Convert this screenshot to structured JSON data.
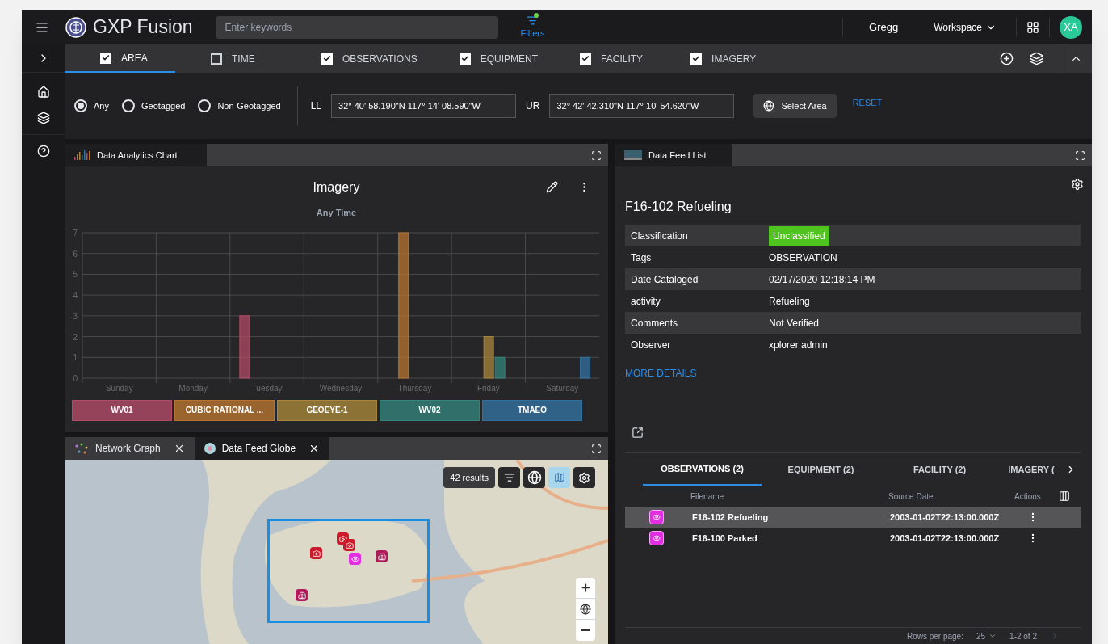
{
  "app": {
    "name": "GXP Fusion"
  },
  "search": {
    "placeholder": "Enter keywords"
  },
  "filters_button": {
    "label": "Filters"
  },
  "user": {
    "name": "Gregg",
    "workspace": "Workspace",
    "initials": "XA"
  },
  "filter_tabs": [
    {
      "label": "AREA",
      "checked": true,
      "selected": true
    },
    {
      "label": "TIME",
      "checked": false,
      "selected": false
    },
    {
      "label": "OBSERVATIONS",
      "checked": true,
      "selected": false
    },
    {
      "label": "EQUIPMENT",
      "checked": true,
      "selected": false
    },
    {
      "label": "FACILITY",
      "checked": true,
      "selected": false
    },
    {
      "label": "IMAGERY",
      "checked": true,
      "selected": false
    }
  ],
  "geo_options": [
    {
      "label": "Any",
      "selected": true
    },
    {
      "label": "Geotagged",
      "selected": false
    },
    {
      "label": "Non-Geotagged",
      "selected": false
    }
  ],
  "coordinates": [
    {
      "label": "LL",
      "value": "32° 40' 58.190\"N 117° 14' 08.590\"W"
    },
    {
      "label": "UR",
      "value": "32° 42' 42.310\"N 117° 10' 54.620\"W"
    }
  ],
  "select_area": "Select Area",
  "reset": "RESET",
  "chart_panel": {
    "tab": "Data Analytics Chart",
    "subtitle": "Any Time",
    "chart_data": {
      "type": "bar",
      "title": "Imagery",
      "grid": true,
      "categories": [
        "Sunday",
        "Monday",
        "Tuesday",
        "Wednesday",
        "Thursday",
        "Friday",
        "Saturday"
      ],
      "ylim": [
        0,
        7
      ],
      "yticks": [
        0,
        1,
        2,
        3,
        4,
        5,
        6,
        7
      ],
      "series": [
        {
          "name": "WV01",
          "color": "#b14b66",
          "values": [
            null,
            null,
            3,
            null,
            null,
            null,
            null
          ]
        },
        {
          "name": "CUBIC RATIONAL ...",
          "color": "#b8742f",
          "values": [
            null,
            null,
            null,
            null,
            7,
            null,
            null
          ]
        },
        {
          "name": "GEOEYE-1",
          "color": "#a8863a",
          "values": [
            null,
            null,
            null,
            null,
            null,
            2,
            null
          ]
        },
        {
          "name": "WV02",
          "color": "#35837a",
          "values": [
            null,
            null,
            null,
            null,
            null,
            1,
            null
          ]
        },
        {
          "name": "TMAEO",
          "color": "#33709f",
          "values": [
            null,
            null,
            null,
            null,
            null,
            null,
            1
          ]
        }
      ]
    }
  },
  "map_panel": {
    "tabs": [
      {
        "label": "Network Graph",
        "selected": false
      },
      {
        "label": "Data Feed Globe",
        "selected": true
      }
    ],
    "results": "42 results"
  },
  "feed_panel": {
    "tab": "Data Feed List",
    "title": "F16-102 Refueling",
    "details": [
      {
        "label": "Classification",
        "value": "Unclassified",
        "kind": "badge"
      },
      {
        "label": "Tags",
        "value": "OBSERVATION",
        "kind": "text"
      },
      {
        "label": "Date Cataloged",
        "value": "02/17/2020 12:18:14 PM",
        "kind": "text"
      },
      {
        "label": "activity",
        "value": "Refueling",
        "kind": "text"
      },
      {
        "label": "Comments",
        "value": "Not Verified",
        "kind": "text"
      },
      {
        "label": "Observer",
        "value": "xplorer admin",
        "kind": "text"
      }
    ],
    "more": "MORE DETAILS",
    "tabs": [
      {
        "label": "OBSERVATIONS (2)",
        "selected": true
      },
      {
        "label": "EQUIPMENT (2)",
        "selected": false
      },
      {
        "label": "FACILITY (2)",
        "selected": false
      },
      {
        "label": "IMAGERY (",
        "selected": false
      }
    ],
    "columns": [
      "Filename",
      "Source Date",
      "Actions"
    ],
    "rows": [
      {
        "filename": "F16-102 Refueling",
        "date": "2003-01-02T22:13:00.000Z",
        "selected": true
      },
      {
        "filename": "F16-100 Parked",
        "date": "2003-01-02T22:13:00.000Z",
        "selected": false
      }
    ],
    "pagination": {
      "rows_label": "Rows per page:",
      "rows_value": "25",
      "range": "1-2 of 2"
    }
  }
}
